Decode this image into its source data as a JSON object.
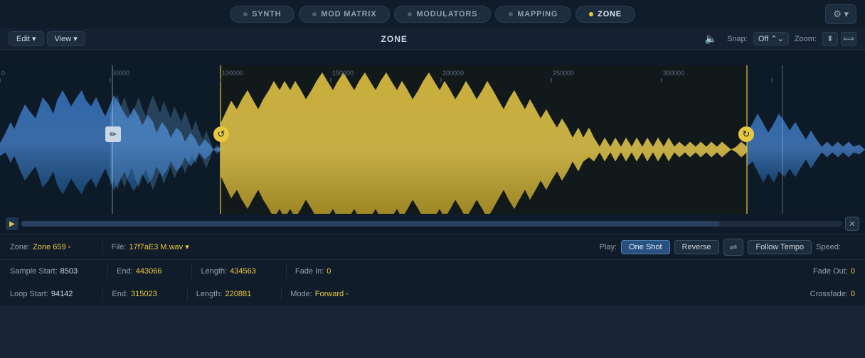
{
  "nav": {
    "tabs": [
      {
        "id": "synth",
        "label": "SYNTH",
        "active": false,
        "dot_color": "#4a6070"
      },
      {
        "id": "mod_matrix",
        "label": "MOD MATRIX",
        "active": false,
        "dot_color": "#4a6070"
      },
      {
        "id": "modulators",
        "label": "MODULATORS",
        "active": false,
        "dot_color": "#4a6070"
      },
      {
        "id": "mapping",
        "label": "MAPPING",
        "active": false,
        "dot_color": "#4a6070"
      },
      {
        "id": "zone",
        "label": "ZONE",
        "active": true,
        "dot_color": "#e8c840"
      }
    ],
    "gear_label": "⚙ ▾"
  },
  "toolbar": {
    "edit_label": "Edit ▾",
    "view_label": "View ▾",
    "title": "ZONE",
    "snap_label": "Snap:",
    "snap_value": "Off",
    "zoom_label": "Zoom:"
  },
  "waveform": {
    "ruler_marks": [
      "0",
      "50000",
      "100000",
      "150000",
      "200000",
      "250000",
      "300000"
    ],
    "loop_start_pct": 27,
    "loop_end_pct": 88,
    "sample_start_pct": 13,
    "sample_end_pct": 96
  },
  "info": {
    "zone_label": "Zone:",
    "zone_value": "Zone 659 ◦",
    "file_label": "File:",
    "file_value": "17f7aE3 M.wav ▾",
    "play_label": "Play:",
    "play_one_shot": "One Shot",
    "play_reverse": "Reverse",
    "follow_tempo": "Follow Tempo",
    "speed_label": "Speed:"
  },
  "stats_row1": {
    "sample_start_label": "Sample Start:",
    "sample_start_value": "8503",
    "end_label": "End:",
    "end_value": "443066",
    "length_label": "Length:",
    "length_value": "434563",
    "fade_in_label": "Fade In:",
    "fade_in_value": "0",
    "fade_out_label": "Fade Out:",
    "fade_out_value": "0"
  },
  "stats_row2": {
    "loop_start_label": "Loop Start:",
    "loop_start_value": "94142",
    "end_label": "End:",
    "end_value": "315023",
    "length_label": "Length:",
    "length_value": "220881",
    "mode_label": "Mode:",
    "mode_value": "Forward ◦",
    "crossfade_label": "Crossfade:",
    "crossfade_value": "0"
  }
}
